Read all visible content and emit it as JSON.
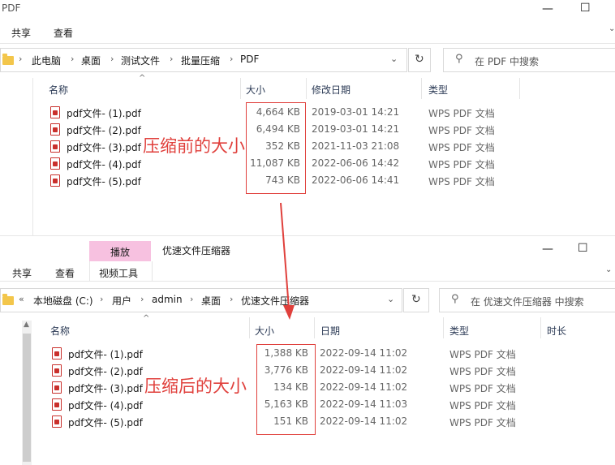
{
  "window1": {
    "title": "PDF",
    "tabs": [
      "共享",
      "查看"
    ],
    "controls": {
      "minimize": "—",
      "maximize": "☐"
    },
    "breadcrumb": [
      "此电脑",
      "桌面",
      "测试文件",
      "批量压缩",
      "PDF"
    ],
    "search_placeholder": "在 PDF 中搜索",
    "columns": {
      "name": "名称",
      "size": "大小",
      "modified": "修改日期",
      "type": "类型"
    },
    "files": [
      {
        "name": "pdf文件- (1).pdf",
        "size": "4,664 KB",
        "date": "2019-03-01 14:21",
        "type": "WPS PDF 文档"
      },
      {
        "name": "pdf文件- (2).pdf",
        "size": "6,494 KB",
        "date": "2019-03-01 14:21",
        "type": "WPS PDF 文档"
      },
      {
        "name": "pdf文件- (3).pdf",
        "size": "352 KB",
        "date": "2021-11-03 21:08",
        "type": "WPS PDF 文档"
      },
      {
        "name": "pdf文件- (4).pdf",
        "size": "11,087 KB",
        "date": "2022-06-06 14:42",
        "type": "WPS PDF 文档"
      },
      {
        "name": "pdf文件- (5).pdf",
        "size": "743 KB",
        "date": "2022-06-06 14:41",
        "type": "WPS PDF 文档"
      }
    ],
    "annotation": "压缩前的大小"
  },
  "window2": {
    "title": "优速文件压缩器",
    "context_tab": "播放",
    "tabs": [
      "共享",
      "查看",
      "视频工具"
    ],
    "controls": {
      "minimize": "—",
      "maximize": "☐"
    },
    "breadcrumb": [
      "本地磁盘 (C:)",
      "用户",
      "admin",
      "桌面",
      "优速文件压缩器"
    ],
    "breadcrumb_overflow": "«",
    "search_placeholder": "在 优速文件压缩器 中搜索",
    "columns": {
      "name": "名称",
      "size": "大小",
      "date": "日期",
      "type": "类型",
      "duration": "时长"
    },
    "files": [
      {
        "name": "pdf文件- (1).pdf",
        "size": "1,388 KB",
        "date": "2022-09-14 11:02",
        "type": "WPS PDF 文档"
      },
      {
        "name": "pdf文件- (2).pdf",
        "size": "3,776 KB",
        "date": "2022-09-14 11:02",
        "type": "WPS PDF 文档"
      },
      {
        "name": "pdf文件- (3).pdf",
        "size": "134 KB",
        "date": "2022-09-14 11:02",
        "type": "WPS PDF 文档"
      },
      {
        "name": "pdf文件- (4).pdf",
        "size": "5,163 KB",
        "date": "2022-09-14 11:03",
        "type": "WPS PDF 文档"
      },
      {
        "name": "pdf文件- (5).pdf",
        "size": "151 KB",
        "date": "2022-09-14 11:02",
        "type": "WPS PDF 文档"
      }
    ],
    "annotation": "压缩后的大小"
  },
  "colors": {
    "annotation_red": "#e0403c",
    "context_tab_pink": "#f7c1e0",
    "folder_yellow": "#f3c64b"
  }
}
